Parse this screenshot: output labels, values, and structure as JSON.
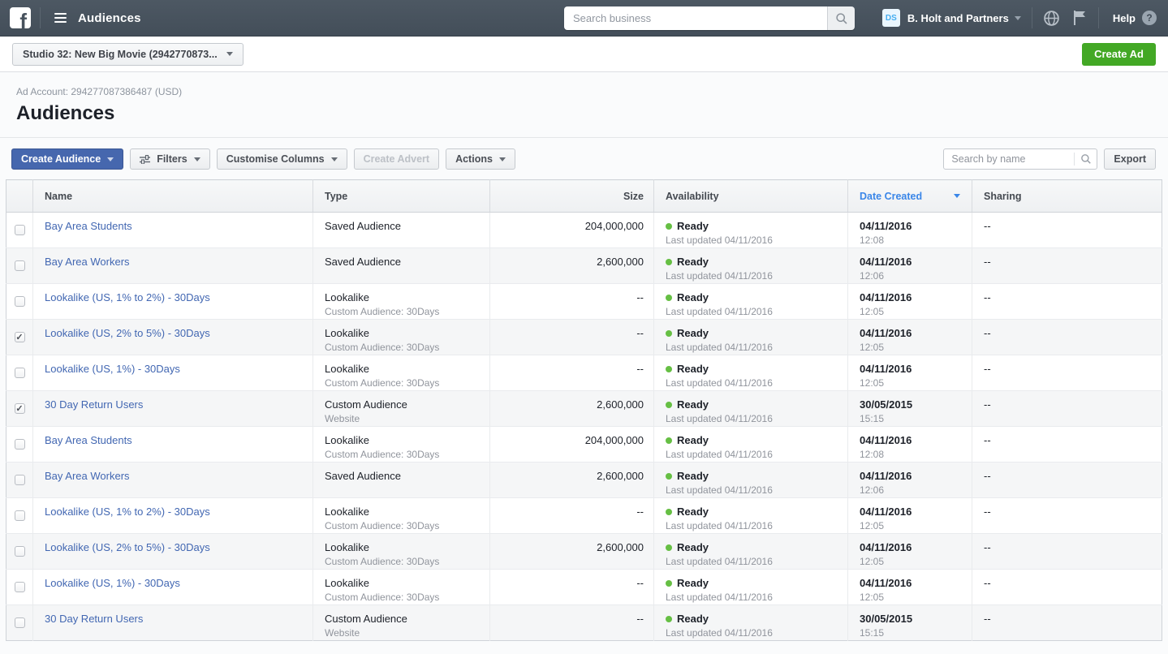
{
  "nav": {
    "app_title": "Audiences",
    "search_placeholder": "Search business",
    "business_initials": "DS",
    "business_name": "B. Holt and Partners",
    "help_label": "Help",
    "help_mark": "?"
  },
  "account_bar": {
    "account_selector_label": "Studio 32: New Big Movie (2942770873...",
    "create_ad_label": "Create Ad"
  },
  "page": {
    "ad_account_line": "Ad Account: 294277087386487 (USD)",
    "title": "Audiences"
  },
  "toolbar": {
    "create_audience_label": "Create Audience",
    "filters_label": "Filters",
    "customise_columns_label": "Customise Columns",
    "create_advert_label": "Create Advert",
    "actions_label": "Actions",
    "search_placeholder": "Search by name",
    "export_label": "Export"
  },
  "table": {
    "columns": [
      "Name",
      "Type",
      "Size",
      "Availability",
      "Date Created",
      "Sharing"
    ],
    "sorted_column": "Date Created",
    "rows": [
      {
        "checked": false,
        "name": "Bay Area Students",
        "type": "Saved Audience",
        "type_sub": "",
        "size": "204,000,000",
        "status": "Ready",
        "status_sub": "Last updated 04/11/2016",
        "date": "04/11/2016",
        "time": "12:08",
        "sharing": "--"
      },
      {
        "checked": false,
        "name": "Bay Area Workers",
        "type": "Saved Audience",
        "type_sub": "",
        "size": "2,600,000",
        "status": "Ready",
        "status_sub": "Last updated 04/11/2016",
        "date": "04/11/2016",
        "time": "12:06",
        "sharing": "--"
      },
      {
        "checked": false,
        "name": "Lookalike (US, 1% to 2%) - 30Days",
        "type": "Lookalike",
        "type_sub": "Custom Audience: 30Days",
        "size": "--",
        "status": "Ready",
        "status_sub": "Last updated 04/11/2016",
        "date": "04/11/2016",
        "time": "12:05",
        "sharing": "--"
      },
      {
        "checked": true,
        "name": "Lookalike (US, 2% to 5%) - 30Days",
        "type": "Lookalike",
        "type_sub": "Custom Audience: 30Days",
        "size": "--",
        "status": "Ready",
        "status_sub": "Last updated 04/11/2016",
        "date": "04/11/2016",
        "time": "12:05",
        "sharing": "--"
      },
      {
        "checked": false,
        "name": "Lookalike (US, 1%) - 30Days",
        "type": "Lookalike",
        "type_sub": "Custom Audience: 30Days",
        "size": "--",
        "status": "Ready",
        "status_sub": "Last updated 04/11/2016",
        "date": "04/11/2016",
        "time": "12:05",
        "sharing": "--"
      },
      {
        "checked": true,
        "name": "30 Day Return Users",
        "type": "Custom Audience",
        "type_sub": "Website",
        "size": "2,600,000",
        "status": "Ready",
        "status_sub": "Last updated 04/11/2016",
        "date": "30/05/2015",
        "time": "15:15",
        "sharing": "--"
      },
      {
        "checked": false,
        "name": "Bay Area Students",
        "type": "Lookalike",
        "type_sub": "Custom Audience: 30Days",
        "size": "204,000,000",
        "status": "Ready",
        "status_sub": "Last updated 04/11/2016",
        "date": "04/11/2016",
        "time": "12:08",
        "sharing": "--"
      },
      {
        "checked": false,
        "name": "Bay Area Workers",
        "type": "Saved Audience",
        "type_sub": "",
        "size": "2,600,000",
        "status": "Ready",
        "status_sub": "Last updated 04/11/2016",
        "date": "04/11/2016",
        "time": "12:06",
        "sharing": "--"
      },
      {
        "checked": false,
        "name": "Lookalike (US, 1% to 2%) - 30Days",
        "type": "Lookalike",
        "type_sub": "Custom Audience: 30Days",
        "size": "--",
        "status": "Ready",
        "status_sub": "Last updated 04/11/2016",
        "date": "04/11/2016",
        "time": "12:05",
        "sharing": "--"
      },
      {
        "checked": false,
        "name": "Lookalike (US, 2% to 5%) - 30Days",
        "type": "Lookalike",
        "type_sub": "Custom Audience: 30Days",
        "size": "2,600,000",
        "status": "Ready",
        "status_sub": "Last updated 04/11/2016",
        "date": "04/11/2016",
        "time": "12:05",
        "sharing": "--"
      },
      {
        "checked": false,
        "name": "Lookalike (US, 1%) - 30Days",
        "type": "Lookalike",
        "type_sub": "Custom Audience: 30Days",
        "size": "--",
        "status": "Ready",
        "status_sub": "Last updated 04/11/2016",
        "date": "04/11/2016",
        "time": "12:05",
        "sharing": "--"
      },
      {
        "checked": false,
        "name": "30 Day Return Users",
        "type": "Custom Audience",
        "type_sub": "Website",
        "size": "--",
        "status": "Ready",
        "status_sub": "Last updated 04/11/2016",
        "date": "30/05/2015",
        "time": "15:15",
        "sharing": "--"
      }
    ]
  },
  "colors": {
    "nav_bg": "#47525d",
    "accent_blue": "#4667ae",
    "sort_blue": "#3a86e8",
    "link_blue": "#4267b2",
    "create_green": "#43a825",
    "ready_dot": "#66bf44"
  }
}
